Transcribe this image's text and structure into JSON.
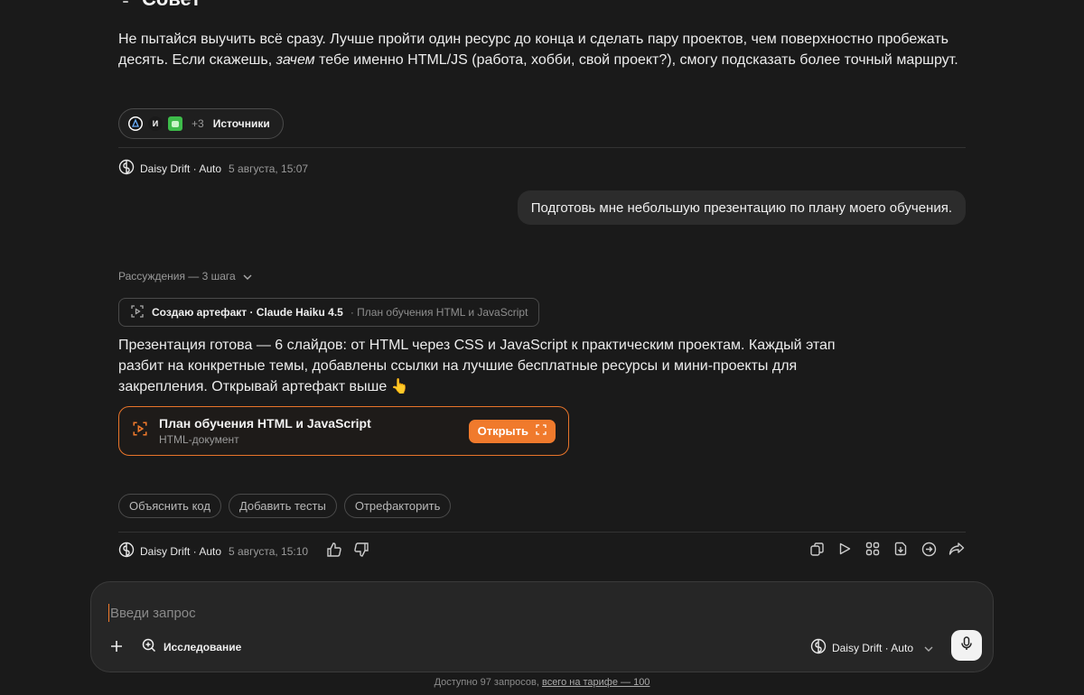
{
  "heading": {
    "icon": "lightbulb-icon",
    "title": "Совет"
  },
  "advice": {
    "text_part1": "Не пытайся выучить всё сразу. Лучше пройти один ресурс до конца и сделать пару проектов, чем поверхностно пробежать десять. Если скажешь, ",
    "text_em": "зачем",
    "text_part2": " тебе именно HTML/JS (работа, хобби, свой проект?), смогу подсказать более точный маршрут."
  },
  "sources": {
    "more": "+3",
    "label": "Источники"
  },
  "meta1": {
    "model": "Daisy Drift · Auto",
    "time": "5 августа, 15:07"
  },
  "user_message": "Подготовь мне небольшую презентацию по плану моего обучения.",
  "reasoning": {
    "label": "Рассуждения — 3 шага"
  },
  "artifact_step": {
    "action": "Создаю артефакт · Claude Haiku 4.5",
    "detail": " · План обучения HTML и JavaScript"
  },
  "answer": {
    "text": "Презентация готова — 6 слайдов: от HTML через CSS и JavaScript к практическим проектам. Каждый этап разбит на конкретные темы, добавлены ссылки на лучшие бесплатные ресурсы и мини-проекты для закрепления. Открывай артефакт выше 👆"
  },
  "artifact_card": {
    "title": "План обучения HTML и JavaScript",
    "subtitle": "HTML-документ",
    "open_label": "Открыть"
  },
  "suggestions": [
    "Объяснить код",
    "Добавить тесты",
    "Отрефакторить"
  ],
  "meta2": {
    "model": "Daisy Drift · Auto",
    "time": "5 августа, 15:10"
  },
  "composer": {
    "placeholder": "Введи запрос",
    "research_label": "Исследование",
    "model_label": "Daisy Drift · Auto"
  },
  "footer": {
    "text": "Доступно 97 запросов, ",
    "link": "всего на тарифе — 100"
  },
  "colors": {
    "accent": "#f07a2c",
    "background": "#1a1a1a",
    "bubble": "#2c2c2c"
  }
}
